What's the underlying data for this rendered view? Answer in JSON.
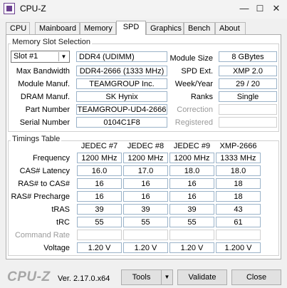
{
  "window": {
    "title": "CPU-Z",
    "controls": {
      "minimize": "—",
      "maximize": "☐",
      "close": "✕"
    }
  },
  "tabs": [
    "CPU",
    "Mainboard",
    "Memory",
    "SPD",
    "Graphics",
    "Bench",
    "About"
  ],
  "active_tab": "SPD",
  "slot_section": {
    "title": "Memory Slot Selection",
    "slot_value": "Slot #1",
    "memory_type": "DDR4 (UDIMM)",
    "left_labels": {
      "max_bandwidth": "Max Bandwidth",
      "module_manuf": "Module Manuf.",
      "dram_manuf": "DRAM Manuf.",
      "part_number": "Part Number",
      "serial_number": "Serial Number"
    },
    "left_values": {
      "max_bandwidth": "DDR4-2666 (1333 MHz)",
      "module_manuf": "TEAMGROUP Inc.",
      "dram_manuf": "SK Hynix",
      "part_number": "TEAMGROUP-UD4-2666",
      "serial_number": "0104C1F8"
    },
    "right_labels": {
      "module_size": "Module Size",
      "spd_ext": "SPD Ext.",
      "week_year": "Week/Year",
      "ranks": "Ranks",
      "correction": "Correction",
      "registered": "Registered"
    },
    "right_values": {
      "module_size": "8 GBytes",
      "spd_ext": "XMP 2.0",
      "week_year": "29 / 20",
      "ranks": "Single",
      "correction": "",
      "registered": ""
    }
  },
  "timings": {
    "title": "Timings Table",
    "columns": [
      "JEDEC #7",
      "JEDEC #8",
      "JEDEC #9",
      "XMP-2666"
    ],
    "rows": [
      {
        "label": "Frequency",
        "values": [
          "1200 MHz",
          "1200 MHz",
          "1200 MHz",
          "1333 MHz"
        ]
      },
      {
        "label": "CAS# Latency",
        "values": [
          "16.0",
          "17.0",
          "18.0",
          "18.0"
        ]
      },
      {
        "label": "RAS# to CAS#",
        "values": [
          "16",
          "16",
          "16",
          "18"
        ]
      },
      {
        "label": "RAS# Precharge",
        "values": [
          "16",
          "16",
          "16",
          "18"
        ]
      },
      {
        "label": "tRAS",
        "values": [
          "39",
          "39",
          "39",
          "43"
        ]
      },
      {
        "label": "tRC",
        "values": [
          "55",
          "55",
          "55",
          "61"
        ]
      },
      {
        "label": "Command Rate",
        "values": [
          "",
          "",
          "",
          ""
        ]
      },
      {
        "label": "Voltage",
        "values": [
          "1.20 V",
          "1.20 V",
          "1.20 V",
          "1.200 V"
        ]
      }
    ]
  },
  "footer": {
    "logo": "CPU-Z",
    "version": "Ver. 2.17.0.x64",
    "tools_label": "Tools",
    "tools_arrow": "▼",
    "validate_label": "Validate",
    "close_label": "Close"
  }
}
